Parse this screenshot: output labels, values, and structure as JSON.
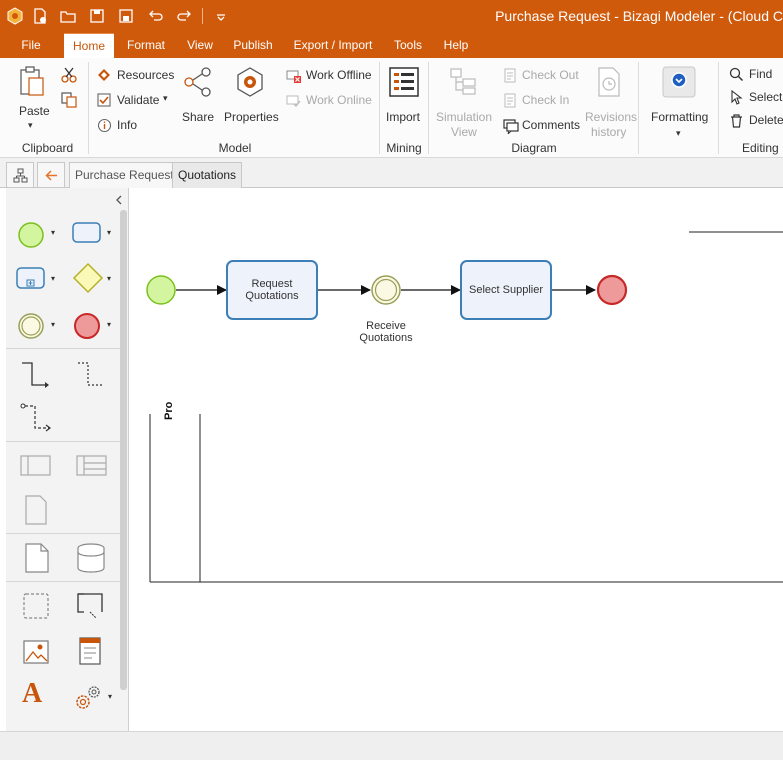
{
  "window": {
    "title": "Purchase Request - Bizagi Modeler - (Cloud C"
  },
  "menu": {
    "file": "File",
    "tabs": [
      "Home",
      "Format",
      "View",
      "Publish",
      "Export / Import",
      "Tools",
      "Help"
    ],
    "active": "Home"
  },
  "ribbon": {
    "clipboard": {
      "paste": "Paste",
      "label": "Clipboard"
    },
    "model": {
      "resources": "Resources",
      "validate": "Validate",
      "info": "Info",
      "share": "Share",
      "properties": "Properties",
      "work_offline": "Work Offline",
      "work_online": "Work Online",
      "label": "Model"
    },
    "mining": {
      "import": "Import",
      "label": "Mining"
    },
    "diagram": {
      "simulation_view_1": "Simulation",
      "simulation_view_2": "View",
      "check_out": "Check Out",
      "check_in": "Check In",
      "comments": "Comments",
      "revisions_1": "Revisions",
      "revisions_2": "history",
      "label": "Diagram"
    },
    "formatting": {
      "label_btn": "Formatting"
    },
    "editing": {
      "find": "Find",
      "select": "Select",
      "delete": "Delete",
      "label": "Editing"
    }
  },
  "doc_tabs": {
    "tab1": "Purchase Request",
    "tab2": "Quotations"
  },
  "diagram": {
    "task1_line1": "Request",
    "task1_line2": "Quotations",
    "event_label_1": "Receive",
    "event_label_2": "Quotations",
    "task2": "Select Supplier",
    "pool_label": "Pro"
  },
  "palette_letter": "A",
  "colors": {
    "accent": "#d05a0c",
    "task_border": "#3b7fb6",
    "start_fill": "#d4f59f",
    "end_fill": "#ef9a9a"
  }
}
